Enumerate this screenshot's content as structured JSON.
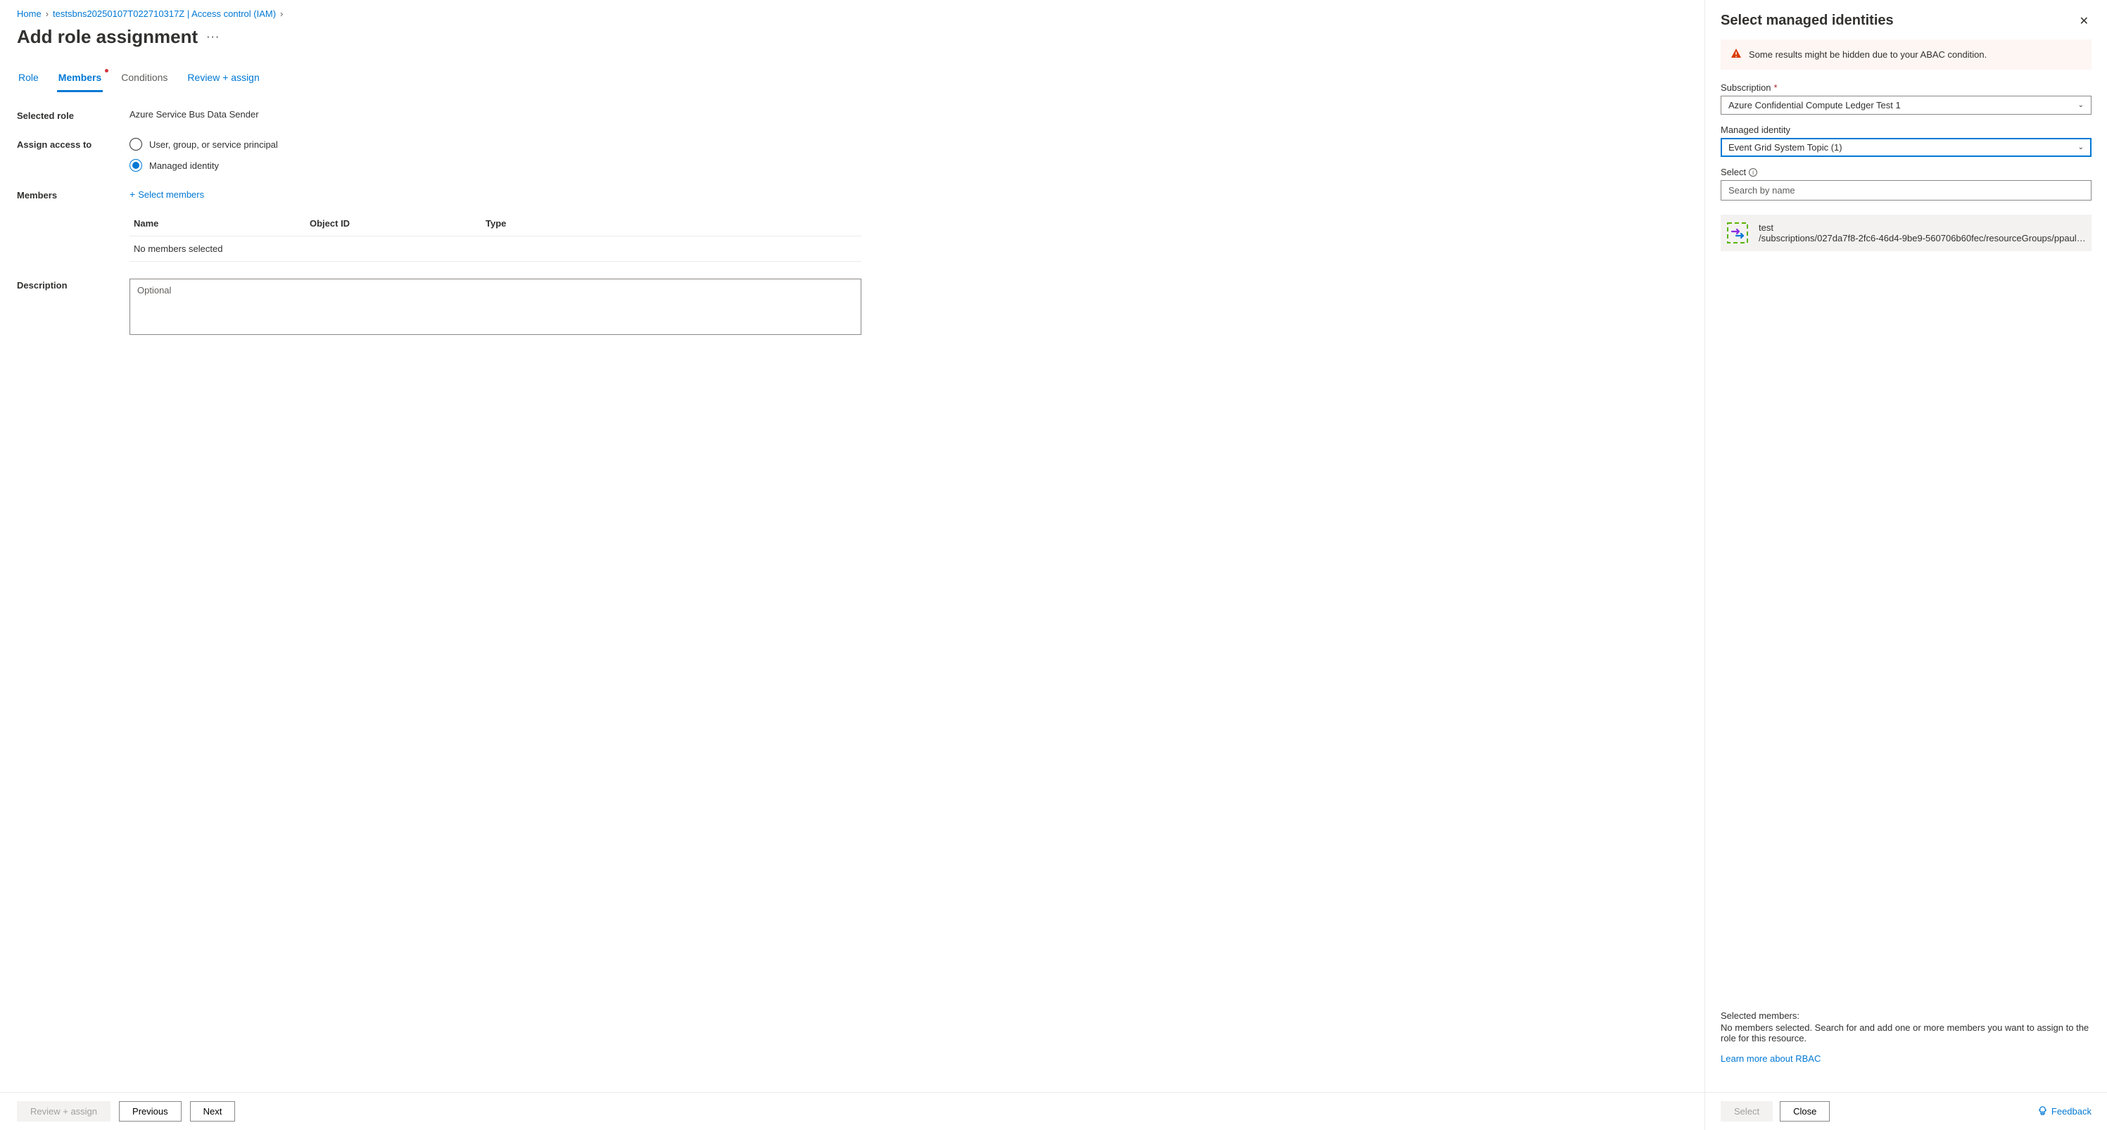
{
  "breadcrumb": {
    "home": "Home",
    "resource": "testsbns20250107T022710317Z | Access control (IAM)"
  },
  "page_title": "Add role assignment",
  "tabs": {
    "role": "Role",
    "members": "Members",
    "conditions": "Conditions",
    "review": "Review + assign"
  },
  "form": {
    "selected_role_label": "Selected role",
    "selected_role_value": "Azure Service Bus Data Sender",
    "assign_access_label": "Assign access to",
    "radio_user": "User, group, or service principal",
    "radio_mi": "Managed identity",
    "members_label": "Members",
    "select_members_link": "Select members",
    "table": {
      "col_name": "Name",
      "col_object_id": "Object ID",
      "col_type": "Type",
      "empty": "No members selected"
    },
    "description_label": "Description",
    "description_placeholder": "Optional"
  },
  "footer": {
    "review": "Review + assign",
    "previous": "Previous",
    "next": "Next"
  },
  "panel": {
    "title": "Select managed identities",
    "warning": "Some results might be hidden due to your ABAC condition.",
    "subscription_label": "Subscription",
    "subscription_value": "Azure Confidential Compute Ledger Test 1",
    "mi_label": "Managed identity",
    "mi_value": "Event Grid System Topic (1)",
    "select_label": "Select",
    "search_placeholder": "Search by name",
    "result": {
      "name": "test",
      "path": "/subscriptions/027da7f8-2fc6-46d4-9be9-560706b60fec/resourceGroups/ppaul-rg…"
    },
    "selected_members_title": "Selected members:",
    "selected_members_desc": "No members selected. Search for and add one or more members you want to assign to the role for this resource.",
    "learn_more": "Learn more about RBAC",
    "footer": {
      "select": "Select",
      "close": "Close",
      "feedback": "Feedback"
    }
  }
}
